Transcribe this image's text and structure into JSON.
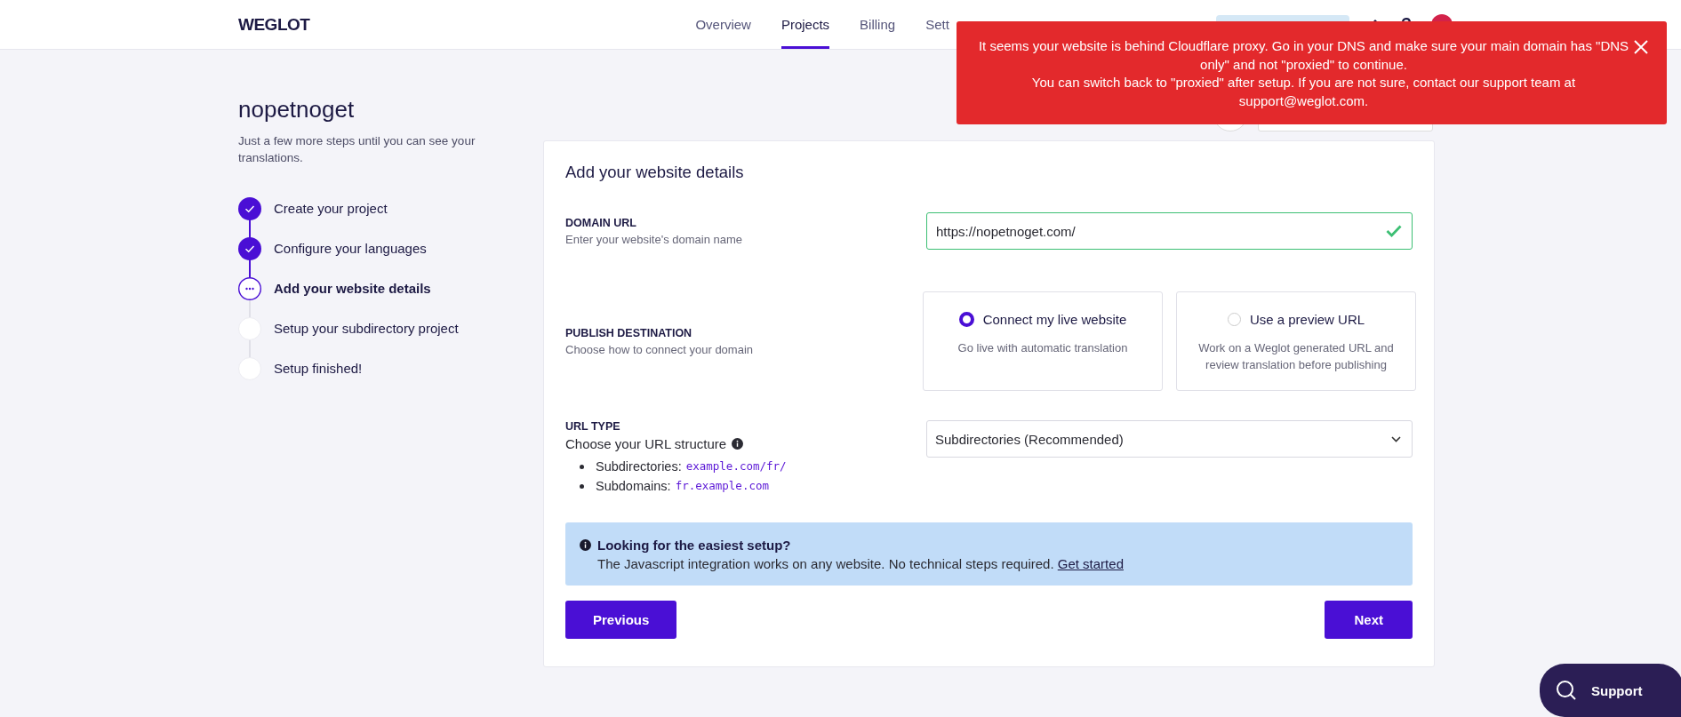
{
  "header": {
    "logo": "WEGLOT",
    "nav": [
      {
        "label": "Overview",
        "selected": false
      },
      {
        "label": "Projects",
        "selected": true
      },
      {
        "label": "Billing",
        "selected": false
      },
      {
        "label": "Sett",
        "selected": false
      }
    ]
  },
  "toast": {
    "lines": [
      "It seems your website is behind Cloudflare proxy. Go in your DNS and make sure your main domain has \"DNS only\" and not \"proxied\" to continue.",
      "You can switch back to \"proxied\" after setup. If you are not sure, contact our support team at support@weglot.com."
    ]
  },
  "project": {
    "title": "nopetnoget",
    "subtitle": "Just a few more steps until you can see your translations."
  },
  "steps": [
    {
      "label": "Create your project",
      "completed": true,
      "selected": false
    },
    {
      "label": "Configure your languages",
      "completed": true,
      "selected": false
    },
    {
      "label": "Add your website details",
      "completed": false,
      "selected": true
    },
    {
      "label": "Setup your subdirectory project",
      "completed": false,
      "selected": false
    },
    {
      "label": "Setup finished!",
      "completed": false,
      "selected": false
    }
  ],
  "card": {
    "title": "Add your website details",
    "domain": {
      "label": "DOMAIN URL",
      "hint": "Enter your website's domain name",
      "value": "https://nopetnoget.com/",
      "valid": true
    },
    "publish": {
      "label": "PUBLISH DESTINATION",
      "hint": "Choose how to connect your domain",
      "options": [
        {
          "title": "Connect my live website",
          "description": "Go live with automatic translation",
          "selected": true
        },
        {
          "title": "Use a preview URL",
          "description": "Work on a Weglot generated URL and review translation before publishing",
          "selected": false
        }
      ]
    },
    "url_type": {
      "label": "URL TYPE",
      "hint": "Choose your URL structure",
      "examples": [
        {
          "name": "Subdirectories:",
          "code": "example.com/fr/"
        },
        {
          "name": "Subdomains:",
          "code": "fr.example.com"
        }
      ],
      "value": "Subdirectories (Recommended)"
    },
    "info": {
      "title": "Looking for the easiest setup?",
      "text": "The Javascript integration works on any website. No technical steps required.",
      "link": "Get started"
    },
    "buttons": {
      "previous": "Previous",
      "next": "Next"
    }
  },
  "support_button": "Support"
}
